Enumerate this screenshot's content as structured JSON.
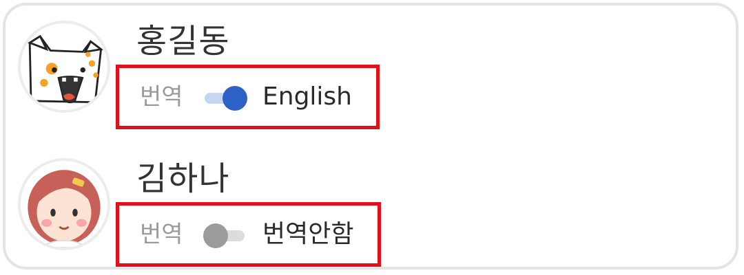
{
  "users": [
    {
      "name": "홍길동",
      "translate_label": "번역",
      "translate_value": "English",
      "translate_on": true,
      "avatar_icon": "cat-avatar-icon"
    },
    {
      "name": "김하나",
      "translate_label": "번역",
      "translate_value": "번역안함",
      "translate_on": false,
      "avatar_icon": "girl-avatar-icon"
    }
  ],
  "colors": {
    "highlight_border": "#e0101a",
    "toggle_on": "#2e61c6",
    "toggle_off": "#9b9b9b"
  }
}
